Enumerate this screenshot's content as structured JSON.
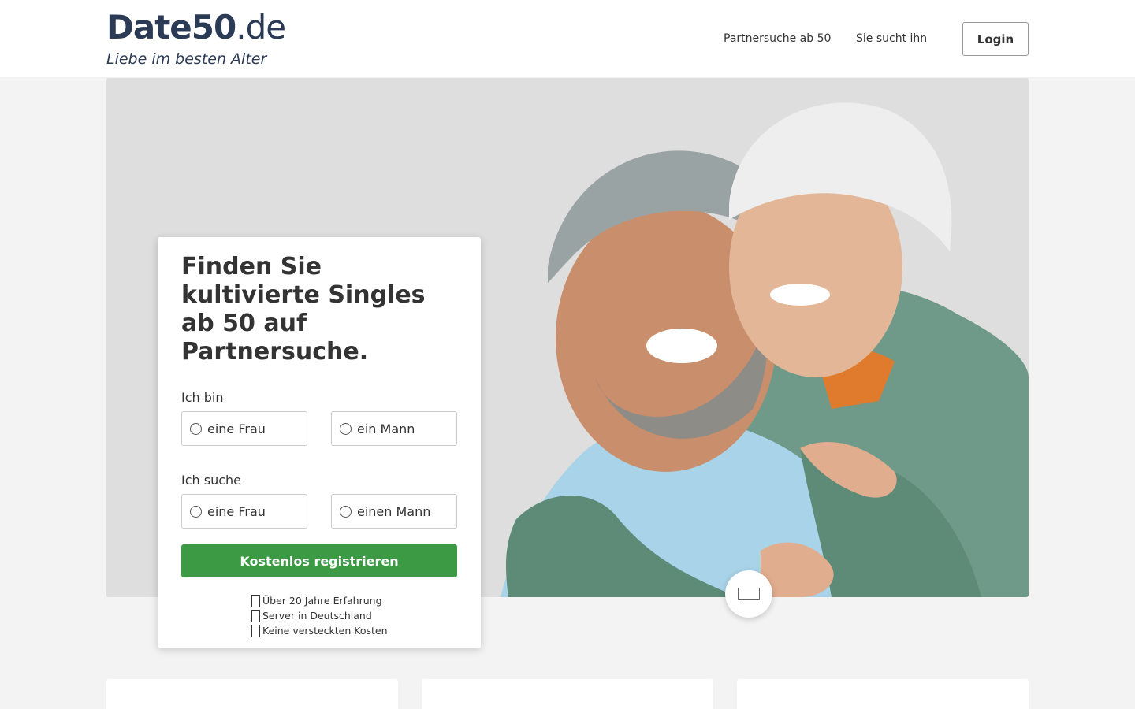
{
  "brand": {
    "logo_main": "Date50",
    "logo_tld": ".de",
    "tagline": "Liebe im besten Alter"
  },
  "nav": {
    "links": [
      "Partnersuche ab 50",
      "Sie sucht ihn"
    ],
    "login_label": "Login"
  },
  "signup": {
    "title": "Finden Sie kultivierte Singles ab 50 auf Partnersuche.",
    "i_am_label": "Ich bin",
    "i_am_options": [
      "eine Frau",
      "ein Mann"
    ],
    "seeking_label": "Ich suche",
    "seeking_options": [
      "eine Frau",
      "einen Mann"
    ],
    "cta_label": "Kostenlos registrieren",
    "features": [
      "Über 20 Jahre Erfahrung",
      "Server in Deutschland",
      "Keine versteckten Kosten"
    ]
  },
  "colors": {
    "brand_navy": "#2b3a55",
    "cta_green": "#3c9a45",
    "page_bg": "#f3f3f3"
  },
  "icons": {
    "feature_icon": "check-icon",
    "scroll_icon": "scroll-down-icon"
  }
}
